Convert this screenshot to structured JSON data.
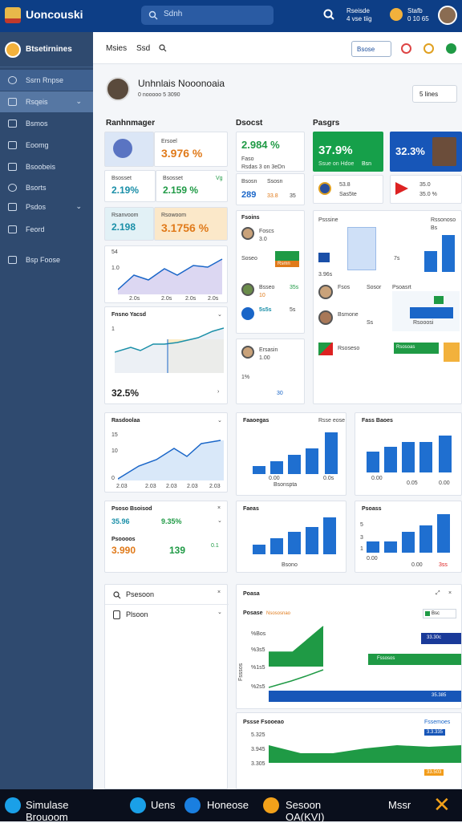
{
  "app": {
    "title": "Uoncouski",
    "search_placeholder": "Sdnh"
  },
  "topbar": {
    "notif_line1": "Rseisde",
    "notif_line2": "4 vse tiig",
    "user_line1": "Stafb",
    "user_line2": "0 10 65"
  },
  "sidebar": {
    "title": "Btsetirnines",
    "items": [
      {
        "label": "Ssrn Rnpse"
      },
      {
        "label": "Rsqeis"
      },
      {
        "label": "Bsmos"
      },
      {
        "label": "Eoomg"
      },
      {
        "label": "Bsoobeis"
      },
      {
        "label": "Bsorts"
      },
      {
        "label": "Psdos"
      },
      {
        "label": "Feord"
      },
      {
        "label": "Bsp Foose"
      }
    ]
  },
  "subheader": {
    "tab1": "Msies",
    "tab2": "Ssd",
    "button": "Bsose"
  },
  "profile": {
    "name": "Unhnlais Nooonoaia",
    "meta": "0 nooooo 5 3090",
    "dropdown": "5 lines"
  },
  "sections": {
    "left": "Ranhnmager",
    "mid": "Dsocst",
    "right": "Pasgrs"
  },
  "kpi": {
    "a_label": "Ersoel",
    "a_value": "3.976 %",
    "b_label": "Bsosset",
    "b_value": "2.19%",
    "c_label": "Bsosset",
    "c_value": "2.159 %",
    "c_tag": "Vg",
    "d_label": "Rsanvoom",
    "d_value": "2.198",
    "e_label": "Rsowoom",
    "e_value": "3.1756 %",
    "f_value": "2.984 %",
    "f_label": "Faso",
    "f_sub": "Rsdas 3 on 3eDn",
    "g_value": "37.9%",
    "g_sub": "Ssue on Hdoe",
    "g_btn": "Bsn",
    "h_value": "32.3%",
    "h_sub": "Bsoos",
    "i_label": "Bsosn",
    "i_sub": "Ssosn",
    "i_v1": "289",
    "i_v2": "33.8",
    "i_v3": "35",
    "j_v1": "53.8",
    "j_v2": "Sas5te",
    "k_v1": "35.0",
    "k_v2": "35.0 %"
  },
  "chart1": {
    "y1": "54",
    "y2": "1.0",
    "x": [
      "2.0s",
      "2.0s",
      "2.0s",
      "2.0s"
    ]
  },
  "chart2": {
    "title": "Fnsno Yacsd",
    "value": "32.5%",
    "y": "1"
  },
  "list_card": {
    "title": "Fsoins",
    "rows": [
      {
        "name": "Foscs",
        "value": "3.0"
      },
      {
        "name": "Soseo",
        "tag": "Rsmn"
      },
      {
        "name": "Bsseo",
        "v": "10",
        "v2": "35s"
      },
      {
        "name": "5s5s",
        "v": "1.9",
        "v2": "5s"
      }
    ]
  },
  "right_list": {
    "title": "Psoasrt",
    "rows": [
      {
        "name": "Fsos",
        "v": "7s"
      },
      {
        "name": "Sosor",
        "v": "Bs"
      },
      {
        "name": "Bsmone",
        "v": "Ss"
      },
      {
        "name": "Rsooosi",
        "v": "Sss"
      }
    ]
  },
  "card_pass": {
    "label": "Psssine",
    "value": "3.96s",
    "tag": "Rssonoso"
  },
  "card_foot": {
    "label": "Ersasin",
    "v1": "1.00",
    "v2": "1%",
    "v3": "30"
  },
  "right_extra": {
    "label": "Rsoseso",
    "btn": "Rsosoas"
  },
  "chart3": {
    "title": "Rasdoolaa",
    "y": [
      "15",
      "10",
      "0"
    ],
    "x": [
      "2.03",
      "2.03",
      "2.03",
      "2.03",
      "2.03"
    ]
  },
  "bar1": {
    "title": "Faaoegas",
    "tag": "Rsse eose",
    "values": [
      1,
      2,
      3,
      4,
      8
    ],
    "xlabel": "Bsonspta",
    "x": [
      "0.00",
      "0.0s"
    ]
  },
  "bar2": {
    "title": "Fass Baoes",
    "values": [
      4,
      4,
      5,
      5,
      6
    ],
    "x": [
      "0.00",
      "0.05",
      "0.00"
    ]
  },
  "kpi2": {
    "title": "Psoso Bsoisod",
    "v1": "35.96",
    "v2": "9.35%",
    "label": "Psoooos",
    "v3": "3.990",
    "v4": "139",
    "v5": "0.1"
  },
  "bar3": {
    "title": "Faeas",
    "values": [
      1,
      2,
      3,
      4,
      5
    ],
    "xlabel": "Bsono"
  },
  "bar4": {
    "title": "Psoass",
    "y": [
      "5",
      "3",
      "1"
    ],
    "values": [
      1,
      1,
      2,
      3,
      5
    ],
    "x": [
      "0.00",
      "0.00"
    ],
    "tag": "3ss"
  },
  "filters": {
    "item1": "Psesoon",
    "item2": "Plsoon"
  },
  "area1": {
    "title": "Poasa",
    "subtitle": "Posase",
    "badge": "Nsososnao",
    "dropdown": "Bsc",
    "y": [
      "%Bos",
      "%3s5",
      "%1s5",
      "%2s5"
    ],
    "labels": [
      "33.30c",
      "Fssosos",
      "35.385"
    ],
    "ylabel": "Fsssos"
  },
  "area2": {
    "title": "Pssse Fsooeao",
    "tag": "Fssemoes",
    "y": [
      "5.325",
      "3.945",
      "3.305"
    ],
    "labels": [
      "3.3.335",
      "33.503"
    ]
  },
  "bottom": {
    "i1": "Simulase Brouoom",
    "i2": "Uens",
    "i3": "Honeose",
    "i4": "Sesoon OA(KVI)",
    "i5": "Mssr"
  }
}
